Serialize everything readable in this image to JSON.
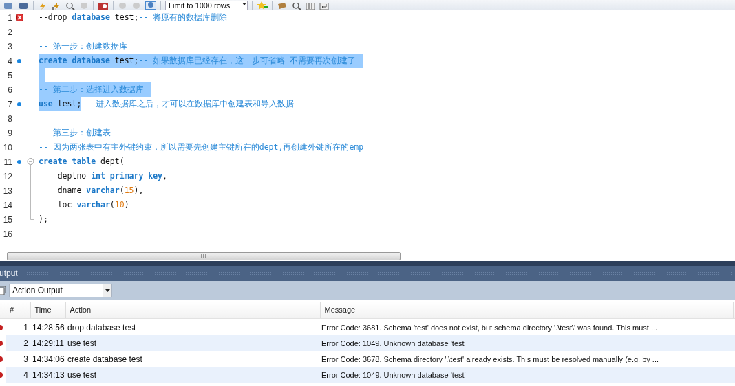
{
  "toolbar": {
    "limit_dropdown": "Limit to 1000 rows"
  },
  "editor": {
    "lines": [
      {
        "number": "1",
        "error": true,
        "statement": false,
        "fold_open": false,
        "fold_guide": false,
        "fold_close": false,
        "eol_selected": false,
        "tokens": [
          {
            "kind": "plain",
            "text": "--drop ",
            "selected": false
          },
          {
            "kind": "keyword",
            "text": "database",
            "selected": false
          },
          {
            "kind": "plain",
            "text": " test;",
            "selected": false
          },
          {
            "kind": "comment",
            "text": "-- 将原有的数据库删除",
            "selected": false
          }
        ]
      },
      {
        "number": "2",
        "error": false,
        "statement": false,
        "fold_open": false,
        "fold_guide": false,
        "fold_close": false,
        "eol_selected": false
      },
      {
        "number": "3",
        "error": false,
        "statement": false,
        "fold_open": false,
        "fold_guide": false,
        "fold_close": false,
        "eol_selected": false,
        "tokens": [
          {
            "kind": "comment",
            "text": "-- 第一步：创建数据库",
            "selected": false
          }
        ]
      },
      {
        "number": "4",
        "error": false,
        "statement": true,
        "fold_open": false,
        "fold_guide": false,
        "fold_close": false,
        "eol_selected": true,
        "tokens": [
          {
            "kind": "keyword",
            "text": "create database",
            "selected": true
          },
          {
            "kind": "plain",
            "text": " test;",
            "selected": true
          },
          {
            "kind": "comment",
            "text": "-- 如果数据库已经存在，这一步可省略 不需要再次创建了",
            "selected": true
          }
        ]
      },
      {
        "number": "5",
        "error": false,
        "statement": false,
        "fold_open": false,
        "fold_guide": false,
        "fold_close": false,
        "eol_selected": true
      },
      {
        "number": "6",
        "error": false,
        "statement": false,
        "fold_open": false,
        "fold_guide": false,
        "fold_close": false,
        "eol_selected": true,
        "tokens": [
          {
            "kind": "comment",
            "text": "-- 第二步：选择进入数据库",
            "selected": true
          }
        ]
      },
      {
        "number": "7",
        "error": false,
        "statement": true,
        "fold_open": false,
        "fold_guide": false,
        "fold_close": false,
        "eol_selected": false,
        "tokens": [
          {
            "kind": "keyword",
            "text": "use",
            "selected": true
          },
          {
            "kind": "plain",
            "text": " test;",
            "selected": true
          },
          {
            "kind": "comment",
            "text": "-- 进入数据库之后，才可以在数据库中创建表和导入数据",
            "selected": false
          }
        ]
      },
      {
        "number": "8",
        "error": false,
        "statement": false,
        "fold_open": false,
        "fold_guide": false,
        "fold_close": false,
        "eol_selected": false
      },
      {
        "number": "9",
        "error": false,
        "statement": false,
        "fold_open": false,
        "fold_guide": false,
        "fold_close": false,
        "eol_selected": false,
        "tokens": [
          {
            "kind": "comment",
            "text": "-- 第三步：创建表",
            "selected": false
          }
        ]
      },
      {
        "number": "10",
        "error": false,
        "statement": false,
        "fold_open": false,
        "fold_guide": false,
        "fold_close": false,
        "eol_selected": false,
        "tokens": [
          {
            "kind": "comment",
            "text": "-- 因为两张表中有主外键约束，所以需要先创建主键所在的dept,再创建外键所在的emp",
            "selected": false
          }
        ]
      },
      {
        "number": "11",
        "error": false,
        "statement": true,
        "fold_open": true,
        "fold_guide": false,
        "fold_close": false,
        "eol_selected": false,
        "tokens": [
          {
            "kind": "keyword",
            "text": "create table",
            "selected": false
          },
          {
            "kind": "plain",
            "text": " dept(",
            "selected": false
          }
        ]
      },
      {
        "number": "12",
        "error": false,
        "statement": false,
        "fold_open": false,
        "fold_guide": true,
        "fold_close": false,
        "eol_selected": false,
        "tokens": [
          {
            "kind": "plain",
            "text": "    deptno ",
            "selected": false
          },
          {
            "kind": "keyword",
            "text": "int primary key",
            "selected": false
          },
          {
            "kind": "plain",
            "text": ",",
            "selected": false
          }
        ]
      },
      {
        "number": "13",
        "error": false,
        "statement": false,
        "fold_open": false,
        "fold_guide": true,
        "fold_close": false,
        "eol_selected": false,
        "tokens": [
          {
            "kind": "plain",
            "text": "    dname ",
            "selected": false
          },
          {
            "kind": "keyword",
            "text": "varchar",
            "selected": false
          },
          {
            "kind": "plain",
            "text": "(",
            "selected": false
          },
          {
            "kind": "number",
            "text": "15",
            "selected": false
          },
          {
            "kind": "plain",
            "text": "),",
            "selected": false
          }
        ]
      },
      {
        "number": "14",
        "error": false,
        "statement": false,
        "fold_open": false,
        "fold_guide": true,
        "fold_close": false,
        "eol_selected": false,
        "tokens": [
          {
            "kind": "plain",
            "text": "    loc ",
            "selected": false
          },
          {
            "kind": "keyword",
            "text": "varchar",
            "selected": false
          },
          {
            "kind": "plain",
            "text": "(",
            "selected": false
          },
          {
            "kind": "number",
            "text": "10",
            "selected": false
          },
          {
            "kind": "plain",
            "text": ")",
            "selected": false
          }
        ]
      },
      {
        "number": "15",
        "error": false,
        "statement": false,
        "fold_open": false,
        "fold_guide": false,
        "fold_close": true,
        "eol_selected": false,
        "tokens": [
          {
            "kind": "plain",
            "text": ");",
            "selected": false
          }
        ]
      },
      {
        "number": "16",
        "error": false,
        "statement": false,
        "fold_open": false,
        "fold_guide": false,
        "fold_close": false,
        "eol_selected": false
      }
    ]
  },
  "output": {
    "title": "utput",
    "view_dropdown": "Action Output",
    "columns": [
      "#",
      "Time",
      "Action",
      "Message"
    ],
    "rows": [
      {
        "error": true,
        "number": "1",
        "time": "14:28:56",
        "action": "drop database test",
        "message": "Error Code: 3681. Schema 'test' does not exist, but schema directory '.\\test\\' was found. This must ..."
      },
      {
        "error": true,
        "number": "2",
        "time": "14:29:11",
        "action": "use test",
        "message": "Error Code: 1049. Unknown database 'test'"
      },
      {
        "error": true,
        "number": "3",
        "time": "14:34:06",
        "action": "create database test",
        "message": "Error Code: 3678. Schema directory '.\\test' already exists. This must be resolved manually (e.g. by ..."
      },
      {
        "error": true,
        "number": "4",
        "time": "14:34:13",
        "action": "use test",
        "message": "Error Code: 1049. Unknown database 'test'"
      }
    ]
  }
}
